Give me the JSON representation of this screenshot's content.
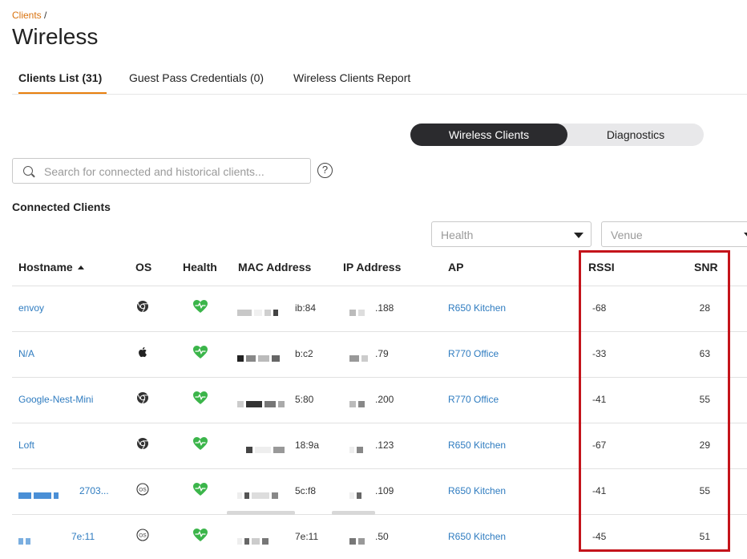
{
  "breadcrumb": {
    "parent": "Clients",
    "separator": "/"
  },
  "page": {
    "title": "Wireless"
  },
  "tabs": [
    {
      "label": "Clients List (31)",
      "active": true
    },
    {
      "label": "Guest Pass Credentials (0)",
      "active": false
    },
    {
      "label": "Wireless Clients Report",
      "active": false
    }
  ],
  "toggle": {
    "options": [
      "Wireless Clients",
      "Diagnostics"
    ],
    "selected": "Wireless Clients"
  },
  "search": {
    "placeholder": "Search for connected and historical clients...",
    "value": ""
  },
  "help_icon": "?",
  "section": {
    "title": "Connected Clients"
  },
  "filters": {
    "health_placeholder": "Health",
    "venue_placeholder": "Venue"
  },
  "table": {
    "columns": [
      "Hostname",
      "OS",
      "Health",
      "MAC Address",
      "IP Address",
      "AP",
      "RSSI",
      "SNR"
    ],
    "sort": {
      "column": "Hostname",
      "direction": "ascending"
    },
    "rows": [
      {
        "hostname": "envoy",
        "os": "chrome-icon",
        "health": "healthy",
        "mac": "ib:84",
        "ip": ".188",
        "ap": "R650 Kitchen",
        "rssi": "-68",
        "snr": "28"
      },
      {
        "hostname": "N/A",
        "os": "apple-icon",
        "health": "healthy",
        "mac": "b:c2",
        "ip": ".79",
        "ap": "R770 Office",
        "rssi": "-33",
        "snr": "63"
      },
      {
        "hostname": "Google-Nest-Mini",
        "os": "chrome-icon",
        "health": "healthy",
        "mac": "5:80",
        "ip": ".200",
        "ap": "R770 Office",
        "rssi": "-41",
        "snr": "55"
      },
      {
        "hostname": "Loft",
        "os": "chrome-icon",
        "health": "healthy",
        "mac": "18:9a",
        "ip": ".123",
        "ap": "R650 Kitchen",
        "rssi": "-67",
        "snr": "29"
      },
      {
        "hostname": "2703...",
        "os": "os-generic-icon",
        "health": "healthy",
        "mac": "5c:f8",
        "ip": ".109",
        "ap": "R650 Kitchen",
        "rssi": "-41",
        "snr": "55"
      },
      {
        "hostname": "7e:11",
        "os": "os-generic-icon",
        "health": "healthy",
        "mac": "7e:11",
        "ip": ".50",
        "ap": "R650 Kitchen",
        "rssi": "-45",
        "snr": "51"
      }
    ]
  },
  "colors": {
    "accent": "#e8800f",
    "link": "#2f7cc0",
    "health": "#3bb54a",
    "highlight": "#c4141b",
    "toggle_active": "#2b2b2e"
  }
}
